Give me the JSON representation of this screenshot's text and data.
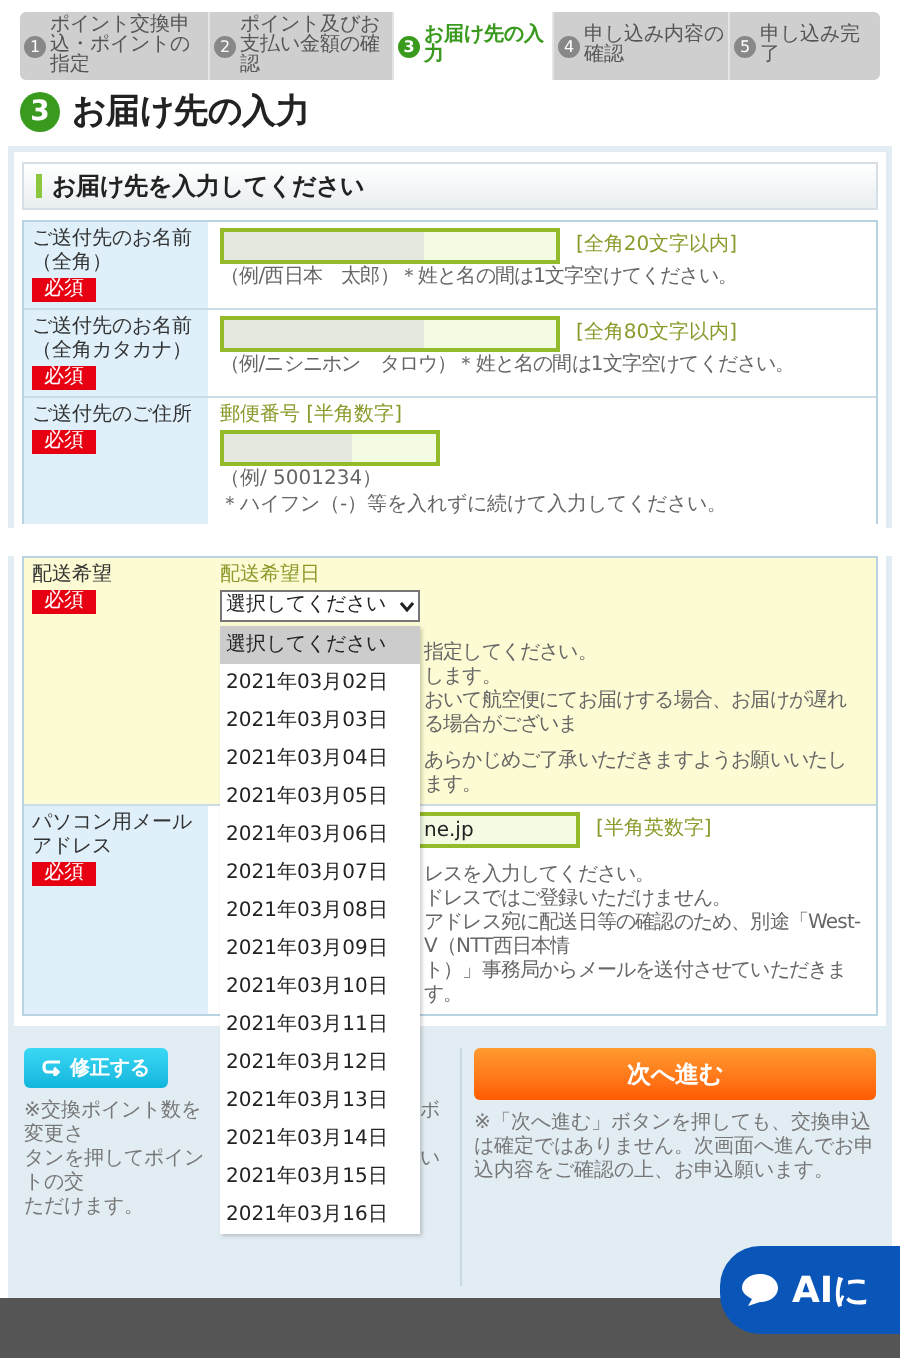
{
  "steps": [
    {
      "number": "1",
      "label": "ポイント交換申込・ポイントの指定",
      "selected": false
    },
    {
      "number": "2",
      "label": "ポイント及びお支払い金額の確認",
      "selected": false
    },
    {
      "number": "3",
      "label": "お届け先の入力",
      "selected": true
    },
    {
      "number": "4",
      "label": "申し込み内容の確認",
      "selected": false
    },
    {
      "number": "5",
      "label": "申し込み完了",
      "selected": false
    }
  ],
  "page_title": {
    "number": "3",
    "text": "お届け先の入力"
  },
  "section_title": "お届け先を入力してください",
  "form_rows": [
    {
      "kind": "name",
      "label": "ご送付先のお名前（全角）",
      "required_badge": "必須",
      "limit": "[全角20文字以内]",
      "hint": "（例/西日本　太郎）＊姓と名の間は1文字空けてください。"
    },
    {
      "kind": "name",
      "label": "ご送付先のお名前（全角カタカナ）",
      "required_badge": "必須",
      "limit": "[全角80文字以内]",
      "hint": "（例/ニシニホン　タロウ）＊姓と名の間は1文字空けてください。"
    },
    {
      "kind": "address",
      "label": "ご送付先のご住所",
      "required_badge": "必須",
      "sublabel": "郵便番号 [半角数字]",
      "example": "（例/ 5001234）",
      "hint": "＊ハイフン（-）等を入れずに続けて入力してください。"
    }
  ],
  "delivery": {
    "label": "配送希望",
    "required_badge": "必須",
    "sublabel": "配送希望日",
    "select_value": "選択してください",
    "notes": [
      "指定してください。",
      "します。",
      "おいて航空便にてお届けする場合、お届けが遅れる場合がございま",
      "あらかじめご了承いただきますようお願いいたします。"
    ],
    "options": [
      {
        "label": "選択してください",
        "selected": true
      },
      {
        "label": "2021年03月02日",
        "selected": false
      },
      {
        "label": "2021年03月03日",
        "selected": false
      },
      {
        "label": "2021年03月04日",
        "selected": false
      },
      {
        "label": "2021年03月05日",
        "selected": false
      },
      {
        "label": "2021年03月06日",
        "selected": false
      },
      {
        "label": "2021年03月07日",
        "selected": false
      },
      {
        "label": "2021年03月08日",
        "selected": false
      },
      {
        "label": "2021年03月09日",
        "selected": false
      },
      {
        "label": "2021年03月10日",
        "selected": false
      },
      {
        "label": "2021年03月11日",
        "selected": false
      },
      {
        "label": "2021年03月12日",
        "selected": false
      },
      {
        "label": "2021年03月13日",
        "selected": false
      },
      {
        "label": "2021年03月14日",
        "selected": false
      },
      {
        "label": "2021年03月15日",
        "selected": false
      },
      {
        "label": "2021年03月16日",
        "selected": false
      }
    ]
  },
  "email": {
    "label": "パソコン用メールアドレス",
    "required_badge": "必須",
    "value": "ne.jp",
    "limit": "[半角英数字]",
    "notes": [
      "レスを入力してください。",
      "ドレスではご登録いただけません。",
      "アドレス宛に配送日等の確認のため、別途「West-V（NTT西日本情",
      "ト）」事務局からメールを送付させていただきます。"
    ]
  },
  "back_button": "修正する",
  "left_note": [
    {
      "left": "※交換ポイント数を変更さ",
      "right": "ボ"
    },
    {
      "left": "タンを押してポイントの交",
      "right": "い"
    },
    {
      "left": "ただけます。"
    }
  ],
  "next_button": "次へ進む",
  "right_note": "※「次へ進む」ボタンを押しても、交換申込は確定ではありません。次画面へ進んでお申込内容をご確認の上、お申込願います。",
  "chat_button": "AIに"
}
